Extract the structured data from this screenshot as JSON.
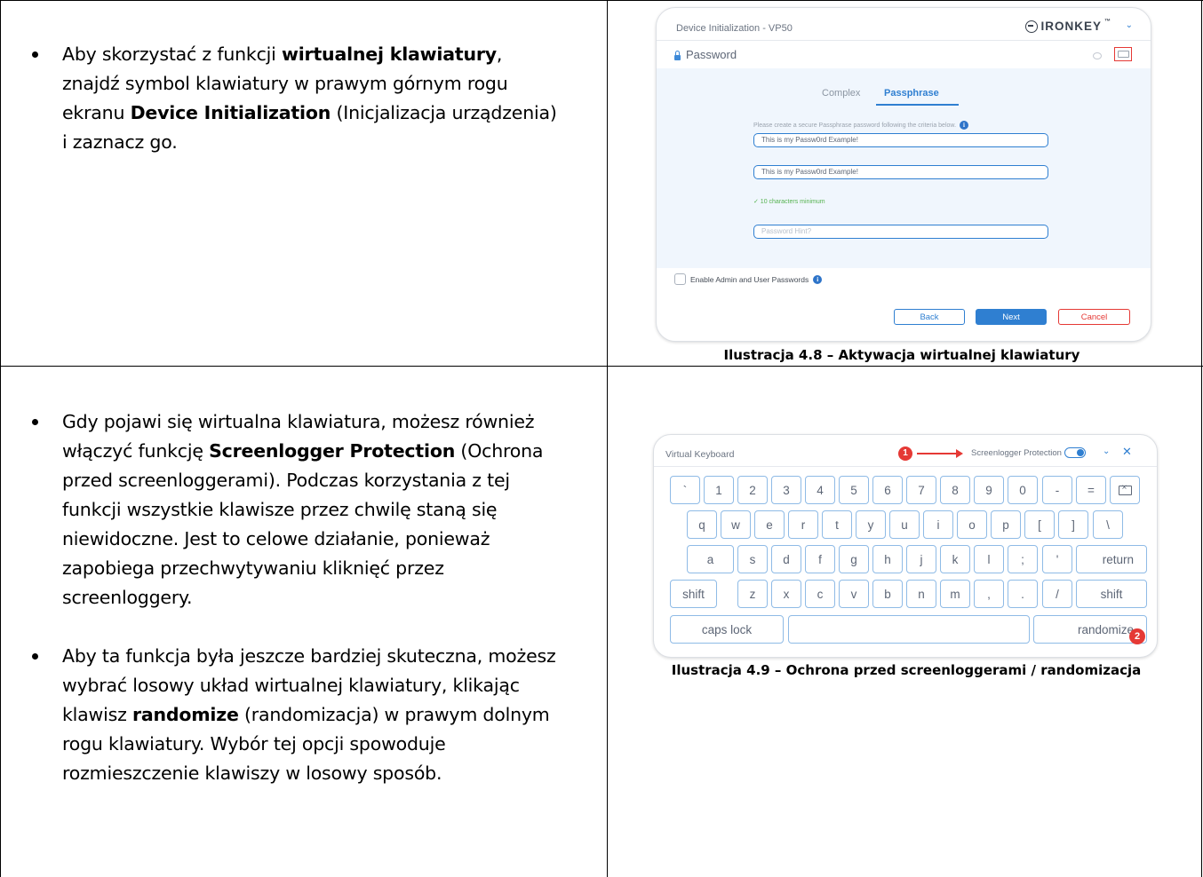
{
  "section1": {
    "bullet": {
      "p1": "Aby skorzystać z funkcji ",
      "b1": "wirtualnej klawiatury",
      "p2": ", znajdź symbol klawiatury w prawym górnym rogu ekranu ",
      "b2": "Device Initialization",
      "p3": " (Inicjalizacja urządzenia) i zaznacz go."
    },
    "caption": "Ilustracja 4.8 – Aktywacja wirtualnej klawiatury"
  },
  "dialog": {
    "title": "Device Initialization - VP50",
    "brand": "IRONKEY",
    "brand_tm": "™",
    "password_label": "Password",
    "tabs": [
      "Complex",
      "Passphrase"
    ],
    "active_tab": "Passphrase",
    "criteria": "Please create a secure Passphrase password following the criteria below.",
    "field1": "This is my Passw0rd Example!",
    "field2": "This is my Passw0rd Example!",
    "min_chars": "✓ 10 characters minimum",
    "hint_placeholder": "Password Hint?",
    "admin_checkbox": "Enable Admin and User Passwords",
    "buttons": {
      "back": "Back",
      "next": "Next",
      "cancel": "Cancel"
    }
  },
  "section2": {
    "bullet1": {
      "p1": "Gdy pojawi się wirtualna klawiatura, możesz również włączyć funkcję ",
      "b1": "Screenlogger Protection",
      "p2": " (Ochrona przed screenloggerami). Podczas korzystania z tej funkcji wszystkie klawisze przez chwilę staną się niewidoczne. Jest to celowe działanie, ponieważ zapobiega przechwytywaniu kliknięć przez screenloggery."
    },
    "bullet2": {
      "p1": "Aby ta funkcja była jeszcze bardziej skuteczna, możesz wybrać losowy układ wirtualnej klawiatury, klikając klawisz ",
      "b1": "randomize",
      "p2": " (randomizacja) w prawym dolnym rogu klawiatury. Wybór tej opcji spowoduje rozmieszczenie klawiszy w losowy sposób."
    },
    "caption": "Ilustracja 4.9 – Ochrona przed screenloggerami / randomizacja"
  },
  "keyboard": {
    "title": "Virtual Keyboard",
    "marker1": "1",
    "marker2": "2",
    "screenlogger_label": "Screenlogger Protection",
    "screenlogger_enabled": true,
    "rows": [
      [
        "`",
        "1",
        "2",
        "3",
        "4",
        "5",
        "6",
        "7",
        "8",
        "9",
        "0",
        "-",
        "=",
        "backspace"
      ],
      [
        "q",
        "w",
        "e",
        "r",
        "t",
        "y",
        "u",
        "i",
        "o",
        "p",
        "[",
        "]",
        "\\"
      ],
      [
        "a",
        "s",
        "d",
        "f",
        "g",
        "h",
        "j",
        "k",
        "l",
        ";",
        "'",
        "return"
      ],
      [
        "shift",
        "z",
        "x",
        "c",
        "v",
        "b",
        "n",
        "m",
        ",",
        ".",
        "/",
        "shift"
      ],
      [
        "caps lock",
        "",
        "randomize"
      ]
    ],
    "icons": {
      "backspace": "backspace-icon",
      "close": "close-icon",
      "collapse": "chevron-down-icon",
      "lock": "lock-icon",
      "keyboard": "keyboard-icon",
      "eye": "eye-icon",
      "info": "info-icon"
    },
    "colors": {
      "accent": "#2f7fd1",
      "marker": "#e53935"
    }
  }
}
